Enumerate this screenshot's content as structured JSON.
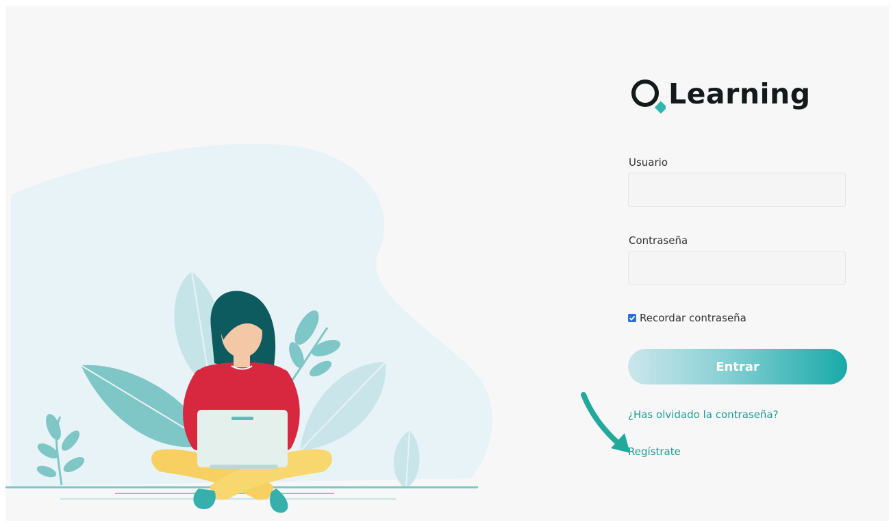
{
  "brand": {
    "name": "Learning",
    "mark_color": "#30b5b2",
    "text_color": "#141a1a"
  },
  "form": {
    "username_label": "Usuario",
    "username_value": "",
    "password_label": "Contraseña",
    "password_value": "",
    "remember_label": "Recordar contraseña",
    "remember_checked": true,
    "submit_label": "Entrar",
    "forgot_link": "¿Has olvidado la contraseña?",
    "register_link": "Regístrate"
  },
  "colors": {
    "accent": "#19aaa8",
    "link": "#1d9b96",
    "annotation_arrow": "#23a99b"
  },
  "icons": {
    "checkbox": "check-icon",
    "annotation": "arrow-down-right-icon"
  }
}
